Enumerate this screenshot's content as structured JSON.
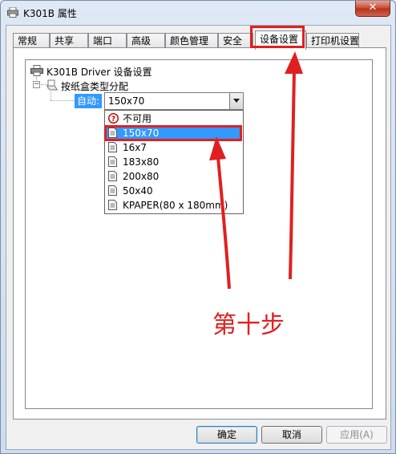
{
  "window": {
    "title": "K301B 属性",
    "close_label": "✕"
  },
  "tabs": [
    {
      "label": "常规"
    },
    {
      "label": "共享"
    },
    {
      "label": "端口"
    },
    {
      "label": "高级"
    },
    {
      "label": "颜色管理"
    },
    {
      "label": "安全"
    },
    {
      "label": "设备设置"
    },
    {
      "label": "打印机设置"
    }
  ],
  "active_tab": "设备设置",
  "tree": {
    "root_label": "K301B Driver 设备设置",
    "child_label": "按纸盒类型分配",
    "auto_label": "自动:",
    "combo_value": "150x70"
  },
  "dropdown": {
    "items": [
      {
        "label": "不可用",
        "icon": "not-available-icon"
      },
      {
        "label": "150x70",
        "icon": "document-icon",
        "selected": true
      },
      {
        "label": "16x7",
        "icon": "document-icon"
      },
      {
        "label": "183x80",
        "icon": "document-icon"
      },
      {
        "label": "200x80",
        "icon": "document-icon"
      },
      {
        "label": "50x40",
        "icon": "document-icon"
      },
      {
        "label": "KPAPER(80 x 180mm)",
        "icon": "document-icon"
      }
    ]
  },
  "annotation": {
    "step_text": "第十步",
    "color": "#e02020"
  },
  "buttons": {
    "ok": "确定",
    "cancel": "取消",
    "apply": "应用(A)"
  },
  "colors": {
    "selection": "#3399ff",
    "annotation": "#e02020"
  }
}
